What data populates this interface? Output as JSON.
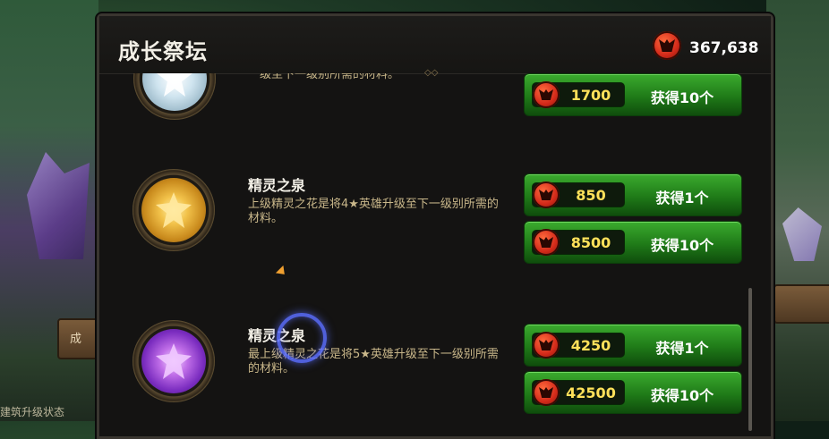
{
  "background": {
    "side_button_label": "成",
    "bottom_text": "建筑升级状态"
  },
  "header": {
    "title": "成长祭坛",
    "balance": "367,638",
    "currency_icon": "red-demon-gem-icon"
  },
  "items": [
    {
      "title": "",
      "description": "级至下一级别所需的材料。",
      "medal": "white-crystal",
      "offers": [
        {
          "price": "1700",
          "label": "获得10个"
        }
      ]
    },
    {
      "title": "精灵之泉",
      "description": "上级精灵之花是将4★英雄升级至下一级别所需的材料。",
      "medal": "gold-crystal",
      "offers": [
        {
          "price": "850",
          "label": "获得1个"
        },
        {
          "price": "8500",
          "label": "获得10个"
        }
      ]
    },
    {
      "title": "精灵之泉",
      "description": "最上级精灵之花是将5★英雄升级至下一级别所需的材料。",
      "medal": "purple-crystal",
      "offers": [
        {
          "price": "4250",
          "label": "获得1个"
        },
        {
          "price": "42500",
          "label": "获得10个"
        }
      ]
    }
  ],
  "colors": {
    "buy_button": "#2a8f22",
    "price_text": "#ffe15a",
    "description_text": "#c9b78a"
  }
}
